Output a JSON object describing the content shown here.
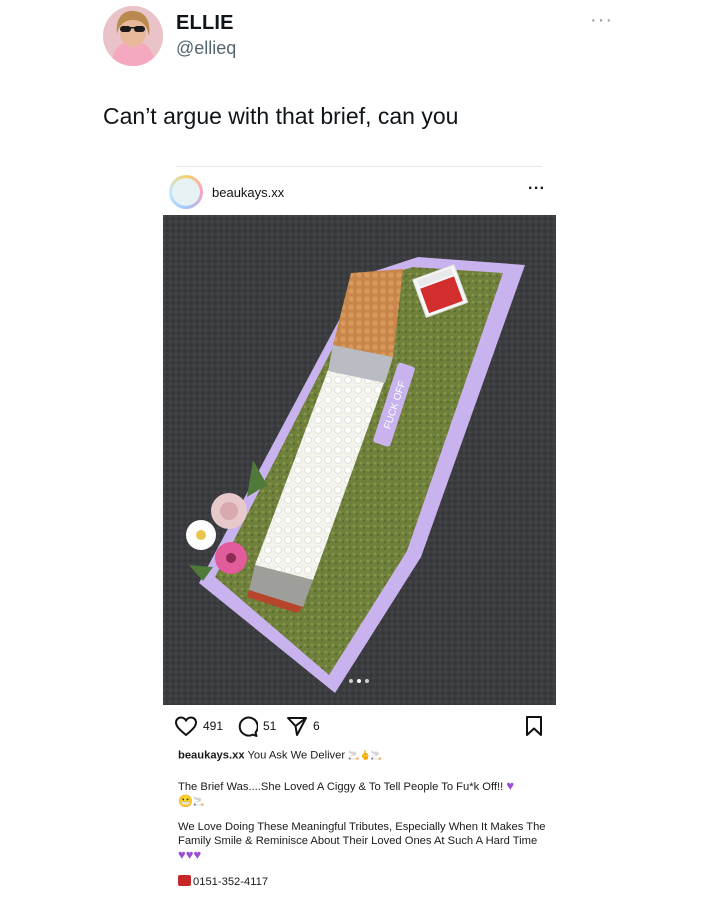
{
  "tweet": {
    "display_name": "ELLIE",
    "handle": "@ellieq",
    "more_label": "···",
    "text": "Can’t argue with that brief, can you"
  },
  "instagram_post": {
    "username": "beaukays.xx",
    "more_label": "···",
    "likes": "491",
    "comments": "51",
    "shares": "6",
    "caption_user": "beaukays.xx",
    "caption_line1": "You Ask We Deliver",
    "caption_para2": "The Brief Was....She Loved A Ciggy & To Tell People To Fu*k Off!!",
    "caption_para3": "We Love Doing These Meaningful Tributes, Especially When It Makes The Family Smile & Reminisce About Their Loved Ones At Such A Hard Time",
    "phone": "0151-352-4117",
    "ribbon_text": "FUCK OFF"
  },
  "colors": {
    "accent_purple": "#9b4fd6",
    "ribbon_lilac": "#c9b3ee",
    "moss_green": "#6f7f3c",
    "asphalt": "#3c3d40"
  }
}
